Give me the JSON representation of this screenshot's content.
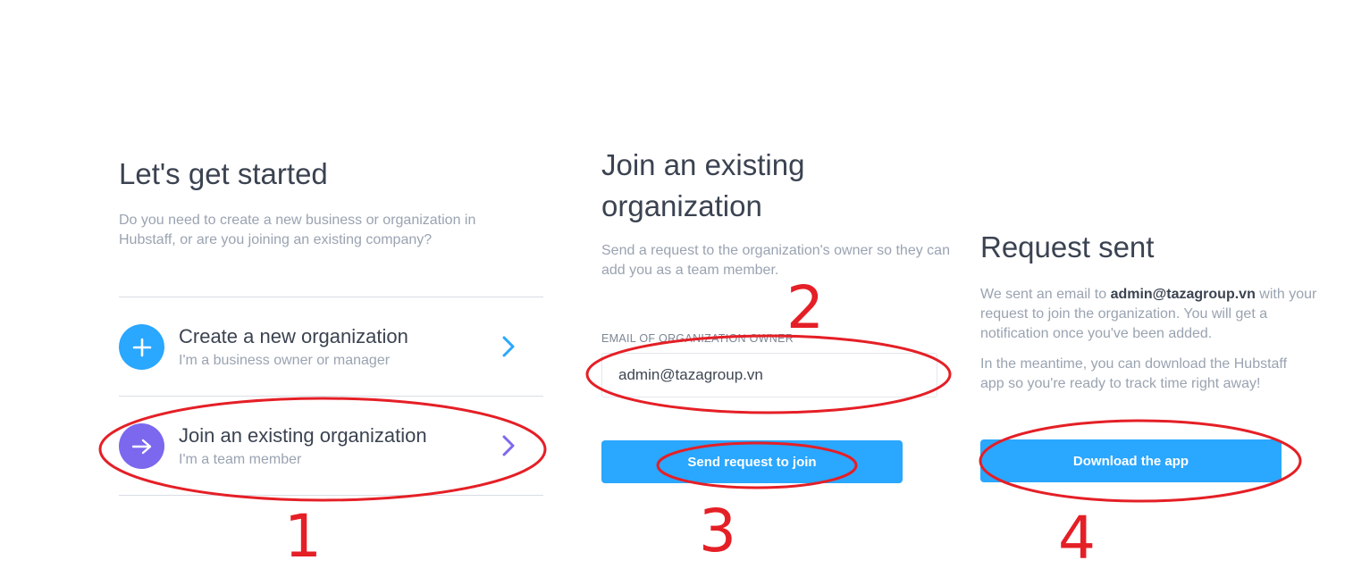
{
  "start": {
    "title": "Let's get started",
    "description": "Do you need to create a new business or organization in Hubstaff, or are you joining an existing company?",
    "options": [
      {
        "title": "Create a new organization",
        "subtitle": "I'm a business owner or manager",
        "icon": "plus-icon",
        "color": "#2aa7ff"
      },
      {
        "title": "Join an existing organization",
        "subtitle": "I'm a team member",
        "icon": "arrow-right-icon",
        "color": "#7b68ee"
      }
    ]
  },
  "join": {
    "title": "Join an existing organization",
    "description": "Send a request to the organization's owner so they can add you as a team member.",
    "email_label": "EMAIL OF ORGANIZATION OWNER",
    "email_value": "admin@tazagroup.vn",
    "submit_label": "Send request to join"
  },
  "sent": {
    "title": "Request sent",
    "desc_prefix": "We sent an email to ",
    "desc_email": "admin@tazagroup.vn",
    "desc_suffix": " with your request to join the organization. You will get a notification once you've been added.",
    "desc2": "In the meantime, you can download the Hubstaff app so you're ready to track time right away!",
    "download_label": "Download the app"
  },
  "annotations": {
    "color": "#e51f26",
    "steps": [
      "1",
      "2",
      "3",
      "4"
    ]
  }
}
